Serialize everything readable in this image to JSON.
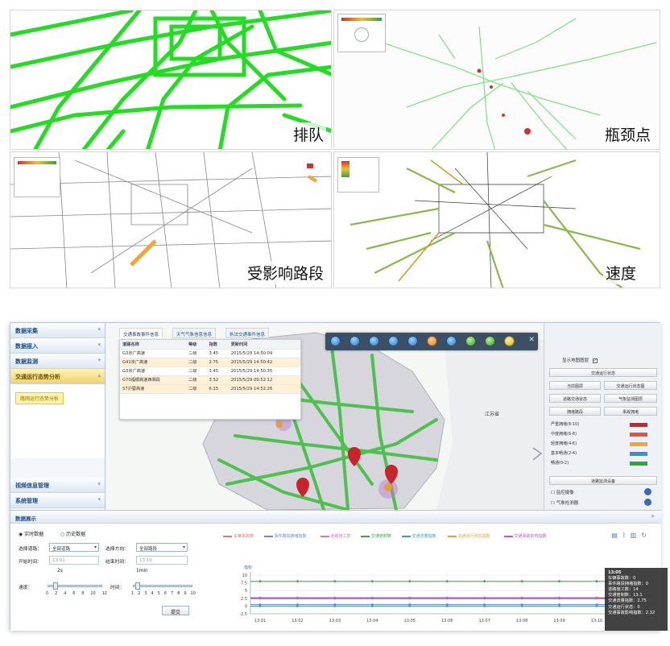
{
  "panels": {
    "queue_label": "排队",
    "bottleneck_label": "瓶颈点",
    "affected_label": "受影响路段",
    "speed_label": "速度"
  },
  "sidebar": {
    "items": [
      {
        "label": "数据采集"
      },
      {
        "label": "数据接入"
      },
      {
        "label": "数据监测"
      },
      {
        "label": "交通运行态势分析"
      }
    ],
    "sub_button": "路网运行态势分析",
    "bottom_items": [
      {
        "label": "视频信息管理"
      },
      {
        "label": "系统管理"
      }
    ]
  },
  "map": {
    "tabs": [
      "交通事故事件信息",
      "天气气象信息信息",
      "执法交通事件信息"
    ],
    "popup": {
      "headers": [
        "道路名称",
        "等级",
        "指数",
        "更新时间"
      ],
      "rows": [
        [
          "G3京广高速",
          "二级",
          "3.45",
          "2015/5/29 14:50:09"
        ],
        [
          "G41京广高速",
          "二级",
          "2.75",
          "2015/5/29 14:50:42"
        ],
        [
          "G3京广高速",
          "二级",
          "3.45",
          "2015/5/29 14:50:35"
        ],
        [
          "G70福银高速西湘段",
          "二级",
          "3.52",
          "2015/5/29 09:52:12"
        ],
        [
          "S7沪蓉高速",
          "二级",
          "6.15",
          "2015/5/29 14:52:26"
        ]
      ]
    },
    "city_label": "江苏省"
  },
  "right_panel": {
    "checkbox_label": "显示地图图层",
    "title": "交通运行状态",
    "buttons_row1": [
      "当前图层",
      "交通运行状态图"
    ],
    "buttons_row2": [
      "道路交通状态",
      "气象监测图层"
    ],
    "buttons_row3": [
      "拥堵路段",
      "事故拥堵"
    ],
    "legend": [
      {
        "label": "严重拥堵(8-10)",
        "color": "#c8242c"
      },
      {
        "label": "中度拥堵(6-8)",
        "color": "#e5533c"
      },
      {
        "label": "轻度拥堵(4-6)",
        "color": "#f0a43a"
      },
      {
        "label": "基本畅通(2-4)",
        "color": "#3b8fd0"
      },
      {
        "label": "畅通(0-2)",
        "color": "#2ea83a"
      }
    ],
    "section2": "道路监测设备",
    "check_items": [
      "监控摄像",
      "气象检测器"
    ]
  },
  "bottom": {
    "title": "数据展示",
    "radio_realtime": "实时数据",
    "radio_history": "历史数据",
    "road_lbl": "选择道路：",
    "road_val": "全部道路",
    "dir_lbl": "选择方向：",
    "dir_val": "全部路段",
    "start_lbl": "开始时间：",
    "start_val": "13:01",
    "end_lbl": "结束时间：",
    "end_val": "13:10",
    "speed_lbl": "速度：",
    "speed_unit": "2s",
    "interval_lbl": "时间：",
    "interval_unit": "1min",
    "slider_ticks": [
      "0",
      "2",
      "4",
      "6",
      "8",
      "10",
      "12"
    ],
    "slider_ticks2": [
      "1",
      "2",
      "3",
      "4",
      "5",
      "6",
      "7",
      "8",
      "9",
      "10"
    ],
    "submit": "提交"
  },
  "chart_data": {
    "type": "line",
    "series": [
      {
        "name": "车辆事故数",
        "color": "#e8766a"
      },
      {
        "name": "事件路段拥堵指数",
        "color": "#6a8ad6"
      },
      {
        "name": "道路施工数",
        "color": "#c87bd8"
      },
      {
        "name": "交通管制数",
        "color": "#3aa64a"
      },
      {
        "name": "交通流量指数",
        "color": "#3a9ad6"
      },
      {
        "name": "交通运行状态指数",
        "color": "#e8a03a"
      },
      {
        "name": "交通事故影响指数",
        "color": "#b65ad6"
      }
    ],
    "x": [
      "13:01",
      "13:02",
      "13:03",
      "13:04",
      "13:05",
      "13:06",
      "13:07",
      "13:08",
      "13:09",
      "13:10"
    ],
    "yticks": [
      "10",
      "7.5",
      "5",
      "2.5",
      "0",
      "-2.5"
    ],
    "ylim": [
      -2.5,
      10
    ],
    "ylabel": "指标"
  },
  "tooltip": [
    "13:05",
    "车辆事故数：0",
    "事件路段拥堵指数：0",
    "道路施工数：14",
    "交通管制数：13.1",
    "交通流量指数：2.75",
    "交通运行状态：0",
    "交通事故影响指数：2.32"
  ],
  "colors": {
    "green_route": "#22dd22",
    "accent": "#1f4c87"
  }
}
